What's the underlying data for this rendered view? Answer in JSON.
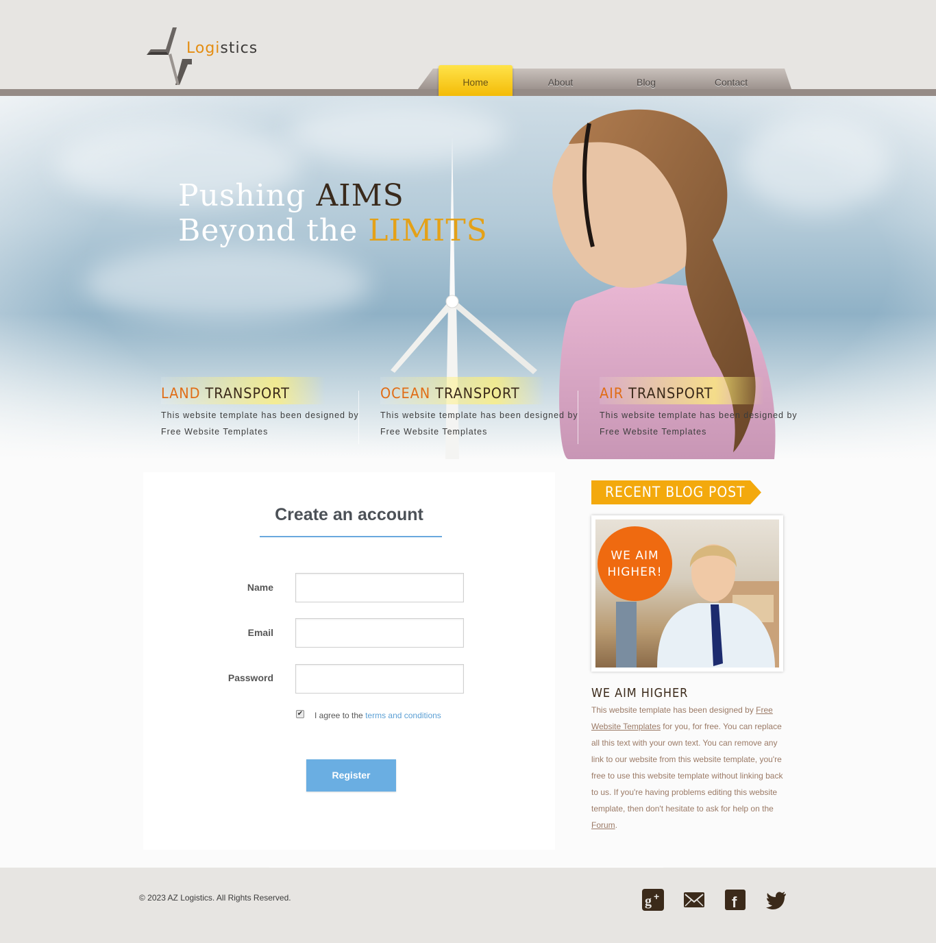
{
  "logo": {
    "text_part1": "Logi",
    "text_part2": "stics"
  },
  "nav": {
    "items": [
      {
        "label": "Home",
        "active": true
      },
      {
        "label": "About",
        "active": false
      },
      {
        "label": "Blog",
        "active": false
      },
      {
        "label": "Contact",
        "active": false
      }
    ]
  },
  "hero": {
    "line1_light": "Pushing",
    "line1_dark": "AIMS",
    "line2_light": "Beyond the",
    "line2_gold": "LIMITS"
  },
  "features": [
    {
      "pre": "LAND",
      "post": "TRANSPORT",
      "text": "This website template has been designed by Free Website Templates"
    },
    {
      "pre": "OCEAN",
      "post": "TRANSPORT",
      "text": "This website template has been designed by Free Website Templates"
    },
    {
      "pre": "AIR",
      "post": "TRANSPORT",
      "text": "This website template has been designed by Free Website Templates"
    }
  ],
  "form": {
    "title": "Create an account",
    "name_label": "Name",
    "email_label": "Email",
    "password_label": "Password",
    "name_value": "",
    "email_value": "",
    "password_value": "",
    "agree_checked": true,
    "agree_text": "I agree to the",
    "agree_link": "terms and conditions",
    "register_label": "Register"
  },
  "sidebar": {
    "banner": "RECENT BLOG POST",
    "photo_badge_line1": "WE AIM",
    "photo_badge_line2": "HIGHER!",
    "post_title": "WE AIM HIGHER",
    "post_text_1": "This website template has been designed by",
    "post_link_1": "Free Website Templates",
    "post_text_2": "for you, for free. You can replace all this text with your own text. You can remove any link to our website from this website template, you're free to use this website template without linking back to us. If you're having problems editing this website template, then don't hesitate to ask for help on the",
    "post_link_2": "Forum",
    "post_text_3": "."
  },
  "footer": {
    "copyright": "© 2023 AZ Logistics. All Rights Reserved.",
    "social": [
      "google-plus-icon",
      "mail-icon",
      "facebook-icon",
      "twitter-icon"
    ]
  },
  "colors": {
    "accent_gold": "#f3a90d",
    "accent_orange": "#e06d16",
    "link_blue": "#5b9fd4",
    "register_blue": "#6aaee2",
    "header_bg": "#e7e5e2",
    "nav_strip": "#958b86"
  }
}
